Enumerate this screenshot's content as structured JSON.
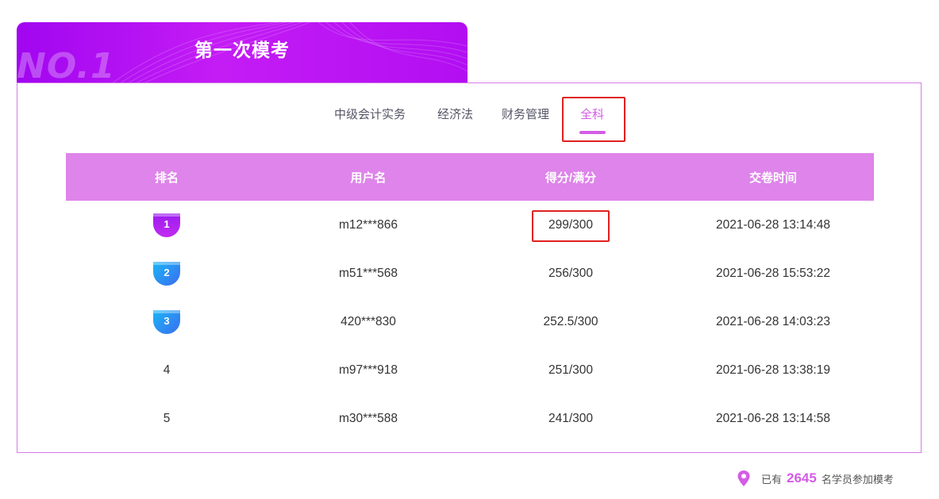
{
  "header": {
    "badge": "NO.1",
    "title": "第一次模考"
  },
  "tabs": [
    {
      "label": "中级会计实务",
      "active": false
    },
    {
      "label": "经济法",
      "active": false
    },
    {
      "label": "财务管理",
      "active": false
    },
    {
      "label": "全科",
      "active": true
    }
  ],
  "table": {
    "headers": [
      "排名",
      "用户名",
      "得分/满分",
      "交卷时间"
    ],
    "rows": [
      {
        "rank": "1",
        "user": "m12***866",
        "score": "299/300",
        "time": "2021-06-28 13:14:48"
      },
      {
        "rank": "2",
        "user": "m51***568",
        "score": "256/300",
        "time": "2021-06-28 15:53:22"
      },
      {
        "rank": "3",
        "user": "420***830",
        "score": "252.5/300",
        "time": "2021-06-28 14:03:23"
      },
      {
        "rank": "4",
        "user": "m97***918",
        "score": "251/300",
        "time": "2021-06-28 13:38:19"
      },
      {
        "rank": "5",
        "user": "m30***588",
        "score": "241/300",
        "time": "2021-06-28 13:14:58"
      }
    ]
  },
  "footer": {
    "prefix": "已有",
    "count": "2645",
    "suffix": "名学员参加模考"
  },
  "colors": {
    "accent": "#d45ce6",
    "header_bg": "#de84ea",
    "highlight": "#e02020"
  },
  "icons": {
    "location": "location-pin-icon"
  }
}
